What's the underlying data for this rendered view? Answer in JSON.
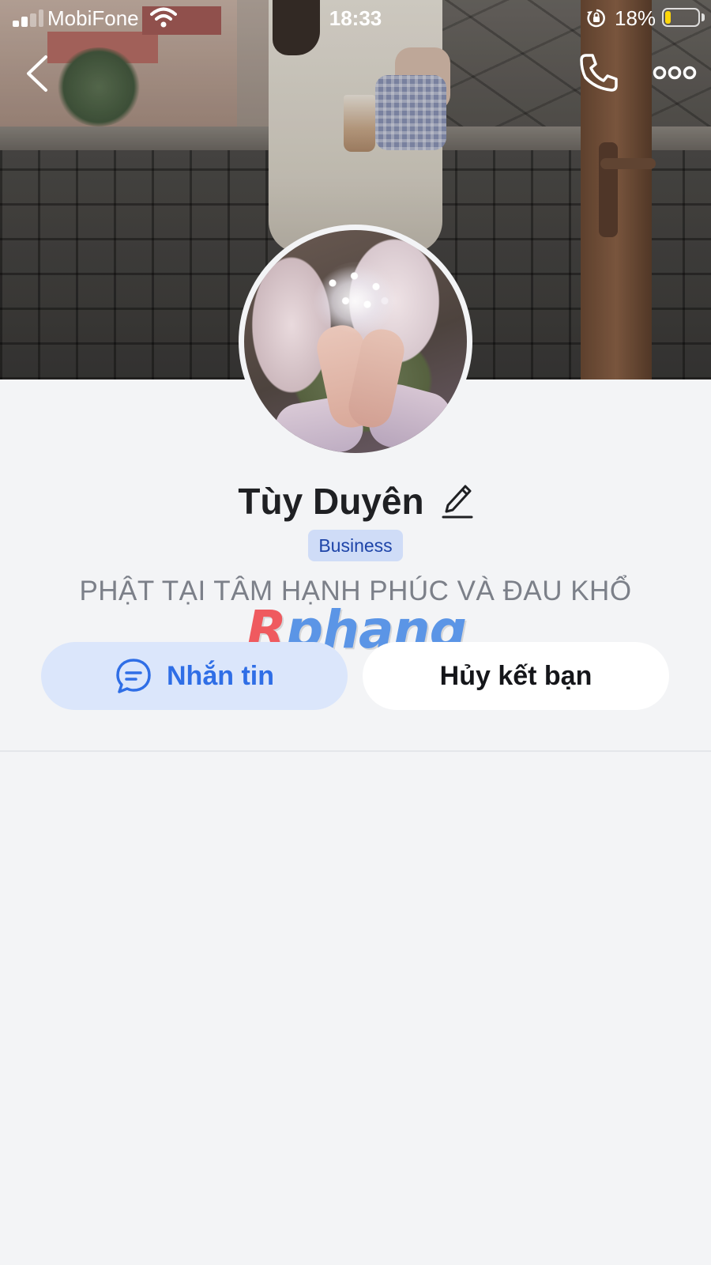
{
  "status_bar": {
    "carrier": "MobiFone",
    "time": "18:33",
    "battery_percent": "18%",
    "battery_level": 0.18,
    "battery_color": "#ffd60a"
  },
  "nav": {
    "back_icon": "chevron-left-icon",
    "call_icon": "phone-icon",
    "more_icon": "more-horizontal-icon"
  },
  "profile": {
    "name": "Tùy Duyên",
    "badge": "Business",
    "bio": "PHẬT TẠI TÂM HẠNH PHÚC VÀ ĐAU KHỔ"
  },
  "watermark": {
    "first_letter": "R",
    "rest": "phang"
  },
  "actions": {
    "message_label": "Nhắn tin",
    "message_icon": "chat-bubble-icon",
    "unfriend_label": "Hủy kết bạn"
  },
  "colors": {
    "accent": "#2f6ee6",
    "message_button_bg": "#dbe6fb",
    "badge_bg": "#cfdcf7",
    "badge_text": "#1e44a8",
    "page_bg": "#f3f4f6"
  }
}
